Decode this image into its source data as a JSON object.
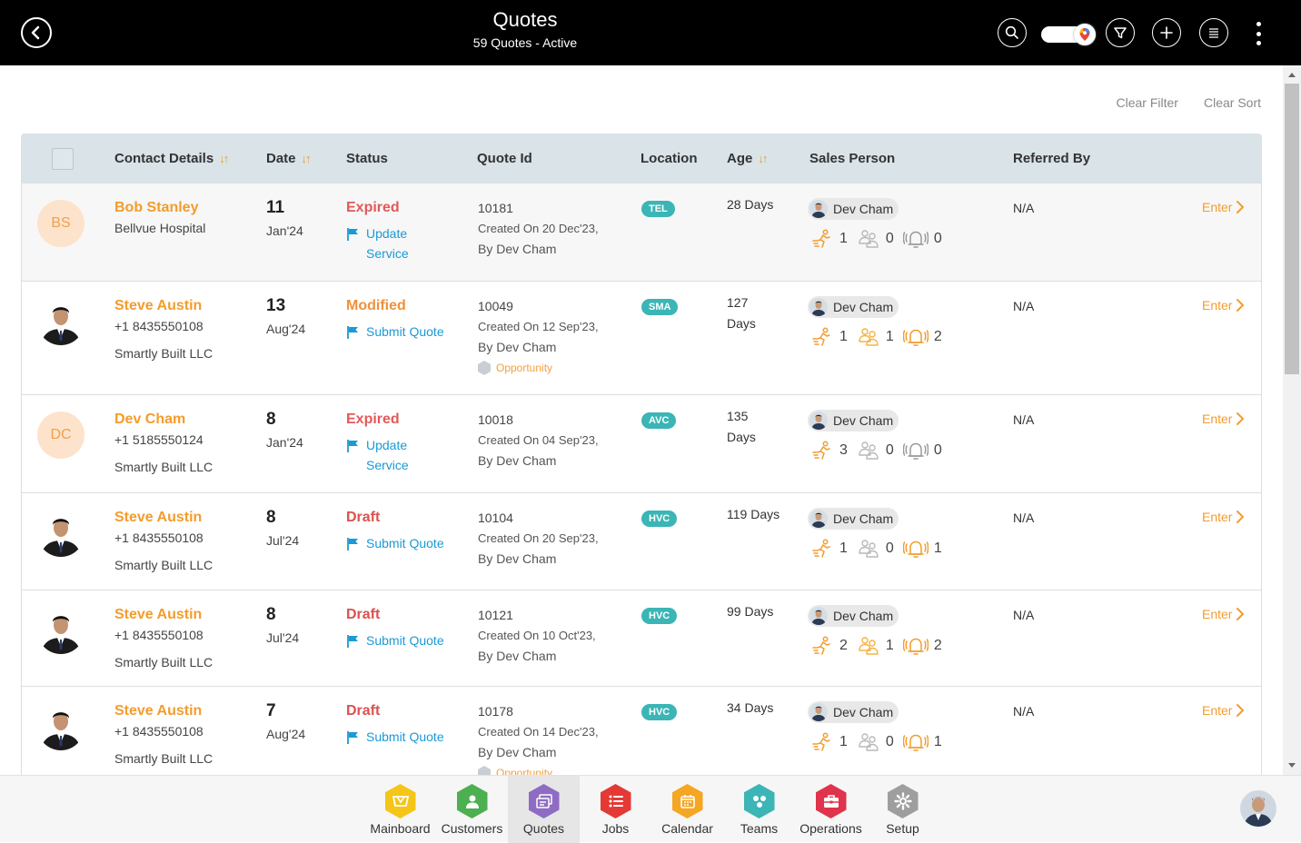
{
  "header": {
    "title": "Quotes",
    "subtitle": "59 Quotes - Active"
  },
  "filters": {
    "clear_filter": "Clear Filter",
    "clear_sort": "Clear Sort"
  },
  "table": {
    "columns": {
      "contact": "Contact Details",
      "date": "Date",
      "status": "Status",
      "quote_id": "Quote Id",
      "location": "Location",
      "age": "Age",
      "sales_person": "Sales Person",
      "referred_by": "Referred By"
    },
    "enter_label": "Enter",
    "rows": [
      {
        "initials": "BS",
        "name": "Bob Stanley",
        "line1": "Bellvue Hospital",
        "line2": "",
        "day": "11",
        "month": "Jan'24",
        "status": "Expired",
        "action_line1": "Update",
        "action_line2": "Service",
        "quote_id": "10181",
        "created": "Created On 20 Dec'23,",
        "by": "By Dev Cham",
        "opportunity": "",
        "location": "TEL",
        "age_line1": "28 Days",
        "age_line2": "",
        "sales_person": "Dev Cham",
        "stat1": "1",
        "stat2": "0",
        "stat3": "0",
        "referred_by": "N/A"
      },
      {
        "initials": "",
        "name": "Steve Austin",
        "line1": "+1 8435550108",
        "line2": "Smartly Built LLC",
        "day": "13",
        "month": "Aug'24",
        "status": "Modified",
        "action_line1": "Submit Quote",
        "action_line2": "",
        "quote_id": "10049",
        "created": "Created On 12 Sep'23,",
        "by": "By Dev Cham",
        "opportunity": "Opportunity",
        "location": "SMA",
        "age_line1": "127",
        "age_line2": "Days",
        "sales_person": "Dev Cham",
        "stat1": "1",
        "stat2": "1",
        "stat3": "2",
        "referred_by": "N/A"
      },
      {
        "initials": "DC",
        "name": "Dev Cham",
        "line1": "+1 5185550124",
        "line2": "Smartly Built LLC",
        "day": "8",
        "month": "Jan'24",
        "status": "Expired",
        "action_line1": "Update",
        "action_line2": "Service",
        "quote_id": "10018",
        "created": "Created On 04 Sep'23,",
        "by": "By Dev Cham",
        "opportunity": "",
        "location": "AVC",
        "age_line1": "135",
        "age_line2": "Days",
        "sales_person": "Dev Cham",
        "stat1": "3",
        "stat2": "0",
        "stat3": "0",
        "referred_by": "N/A"
      },
      {
        "initials": "",
        "name": "Steve Austin",
        "line1": "+1 8435550108",
        "line2": "Smartly Built LLC",
        "day": "8",
        "month": "Jul'24",
        "status": "Draft",
        "action_line1": "Submit Quote",
        "action_line2": "",
        "quote_id": "10104",
        "created": "Created On 20 Sep'23,",
        "by": "By Dev Cham",
        "opportunity": "",
        "location": "HVC",
        "age_line1": "119 Days",
        "age_line2": "",
        "sales_person": "Dev Cham",
        "stat1": "1",
        "stat2": "0",
        "stat3": "1",
        "referred_by": "N/A"
      },
      {
        "initials": "",
        "name": "Steve Austin",
        "line1": "+1 8435550108",
        "line2": "Smartly Built LLC",
        "day": "8",
        "month": "Jul'24",
        "status": "Draft",
        "action_line1": "Submit Quote",
        "action_line2": "",
        "quote_id": "10121",
        "created": "Created On 10 Oct'23,",
        "by": "By Dev Cham",
        "opportunity": "",
        "location": "HVC",
        "age_line1": "99 Days",
        "age_line2": "",
        "sales_person": "Dev Cham",
        "stat1": "2",
        "stat2": "1",
        "stat3": "2",
        "referred_by": "N/A"
      },
      {
        "initials": "",
        "name": "Steve Austin",
        "line1": "+1 8435550108",
        "line2": "Smartly Built LLC",
        "day": "7",
        "month": "Aug'24",
        "status": "Draft",
        "action_line1": "Submit Quote",
        "action_line2": "",
        "quote_id": "10178",
        "created": "Created On 14 Dec'23,",
        "by": "By Dev Cham",
        "opportunity": "Opportunity",
        "location": "HVC",
        "age_line1": "34 Days",
        "age_line2": "",
        "sales_person": "Dev Cham",
        "stat1": "1",
        "stat2": "0",
        "stat3": "1",
        "referred_by": "N/A"
      }
    ]
  },
  "nav": {
    "items": [
      {
        "label": "Mainboard",
        "color": "#f5c518"
      },
      {
        "label": "Customers",
        "color": "#4caf50"
      },
      {
        "label": "Quotes",
        "color": "#8e6cc4"
      },
      {
        "label": "Jobs",
        "color": "#e53935"
      },
      {
        "label": "Calendar",
        "color": "#f5a623"
      },
      {
        "label": "Teams",
        "color": "#3bb5b5"
      },
      {
        "label": "Operations",
        "color": "#e0334c"
      },
      {
        "label": "Setup",
        "color": "#9e9e9e"
      }
    ]
  },
  "colors": {
    "accent": "#f39c2c",
    "link": "#1a9ad6",
    "header_bg": "#000000",
    "table_header_bg": "#d9e3e8",
    "location_badge": "#3bb5b5"
  }
}
